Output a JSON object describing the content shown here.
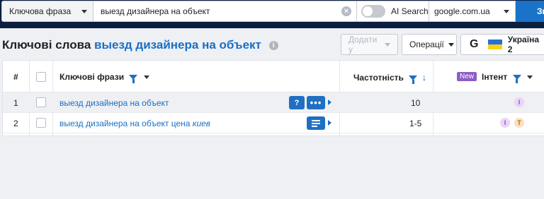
{
  "search": {
    "query_type": "Ключова фраза",
    "query": "выезд дизайнера на объект",
    "ai_search_label": "AI Search",
    "database": "google.com.ua",
    "go_label": "Зн"
  },
  "header": {
    "title_prefix": "Ключові слова",
    "title_keyword": "выезд дизайнера на объект",
    "add_to_label": "Додати у",
    "operations_label": "Операції",
    "google_glyph": "G",
    "region_label": "Україна 2"
  },
  "table": {
    "columns": {
      "num": "#",
      "keyword": "Ключові фрази",
      "frequency": "Частотність",
      "new_badge": "New",
      "intent": "Інтент"
    },
    "rows": [
      {
        "num": "1",
        "keyword": "выезд дизайнера на объект",
        "keyword_italic": "",
        "frequency": "10",
        "intents": [
          "I"
        ]
      },
      {
        "num": "2",
        "keyword": "выезд дизайнера на объект цена ",
        "keyword_italic": "киев",
        "frequency": "1-5",
        "intents": [
          "I",
          "T"
        ]
      }
    ]
  },
  "colors": {
    "topbar": "#0b1e3f",
    "link": "#1a6fc4",
    "primary": "#1a73c8",
    "new_badge": "#8e5cc6"
  }
}
